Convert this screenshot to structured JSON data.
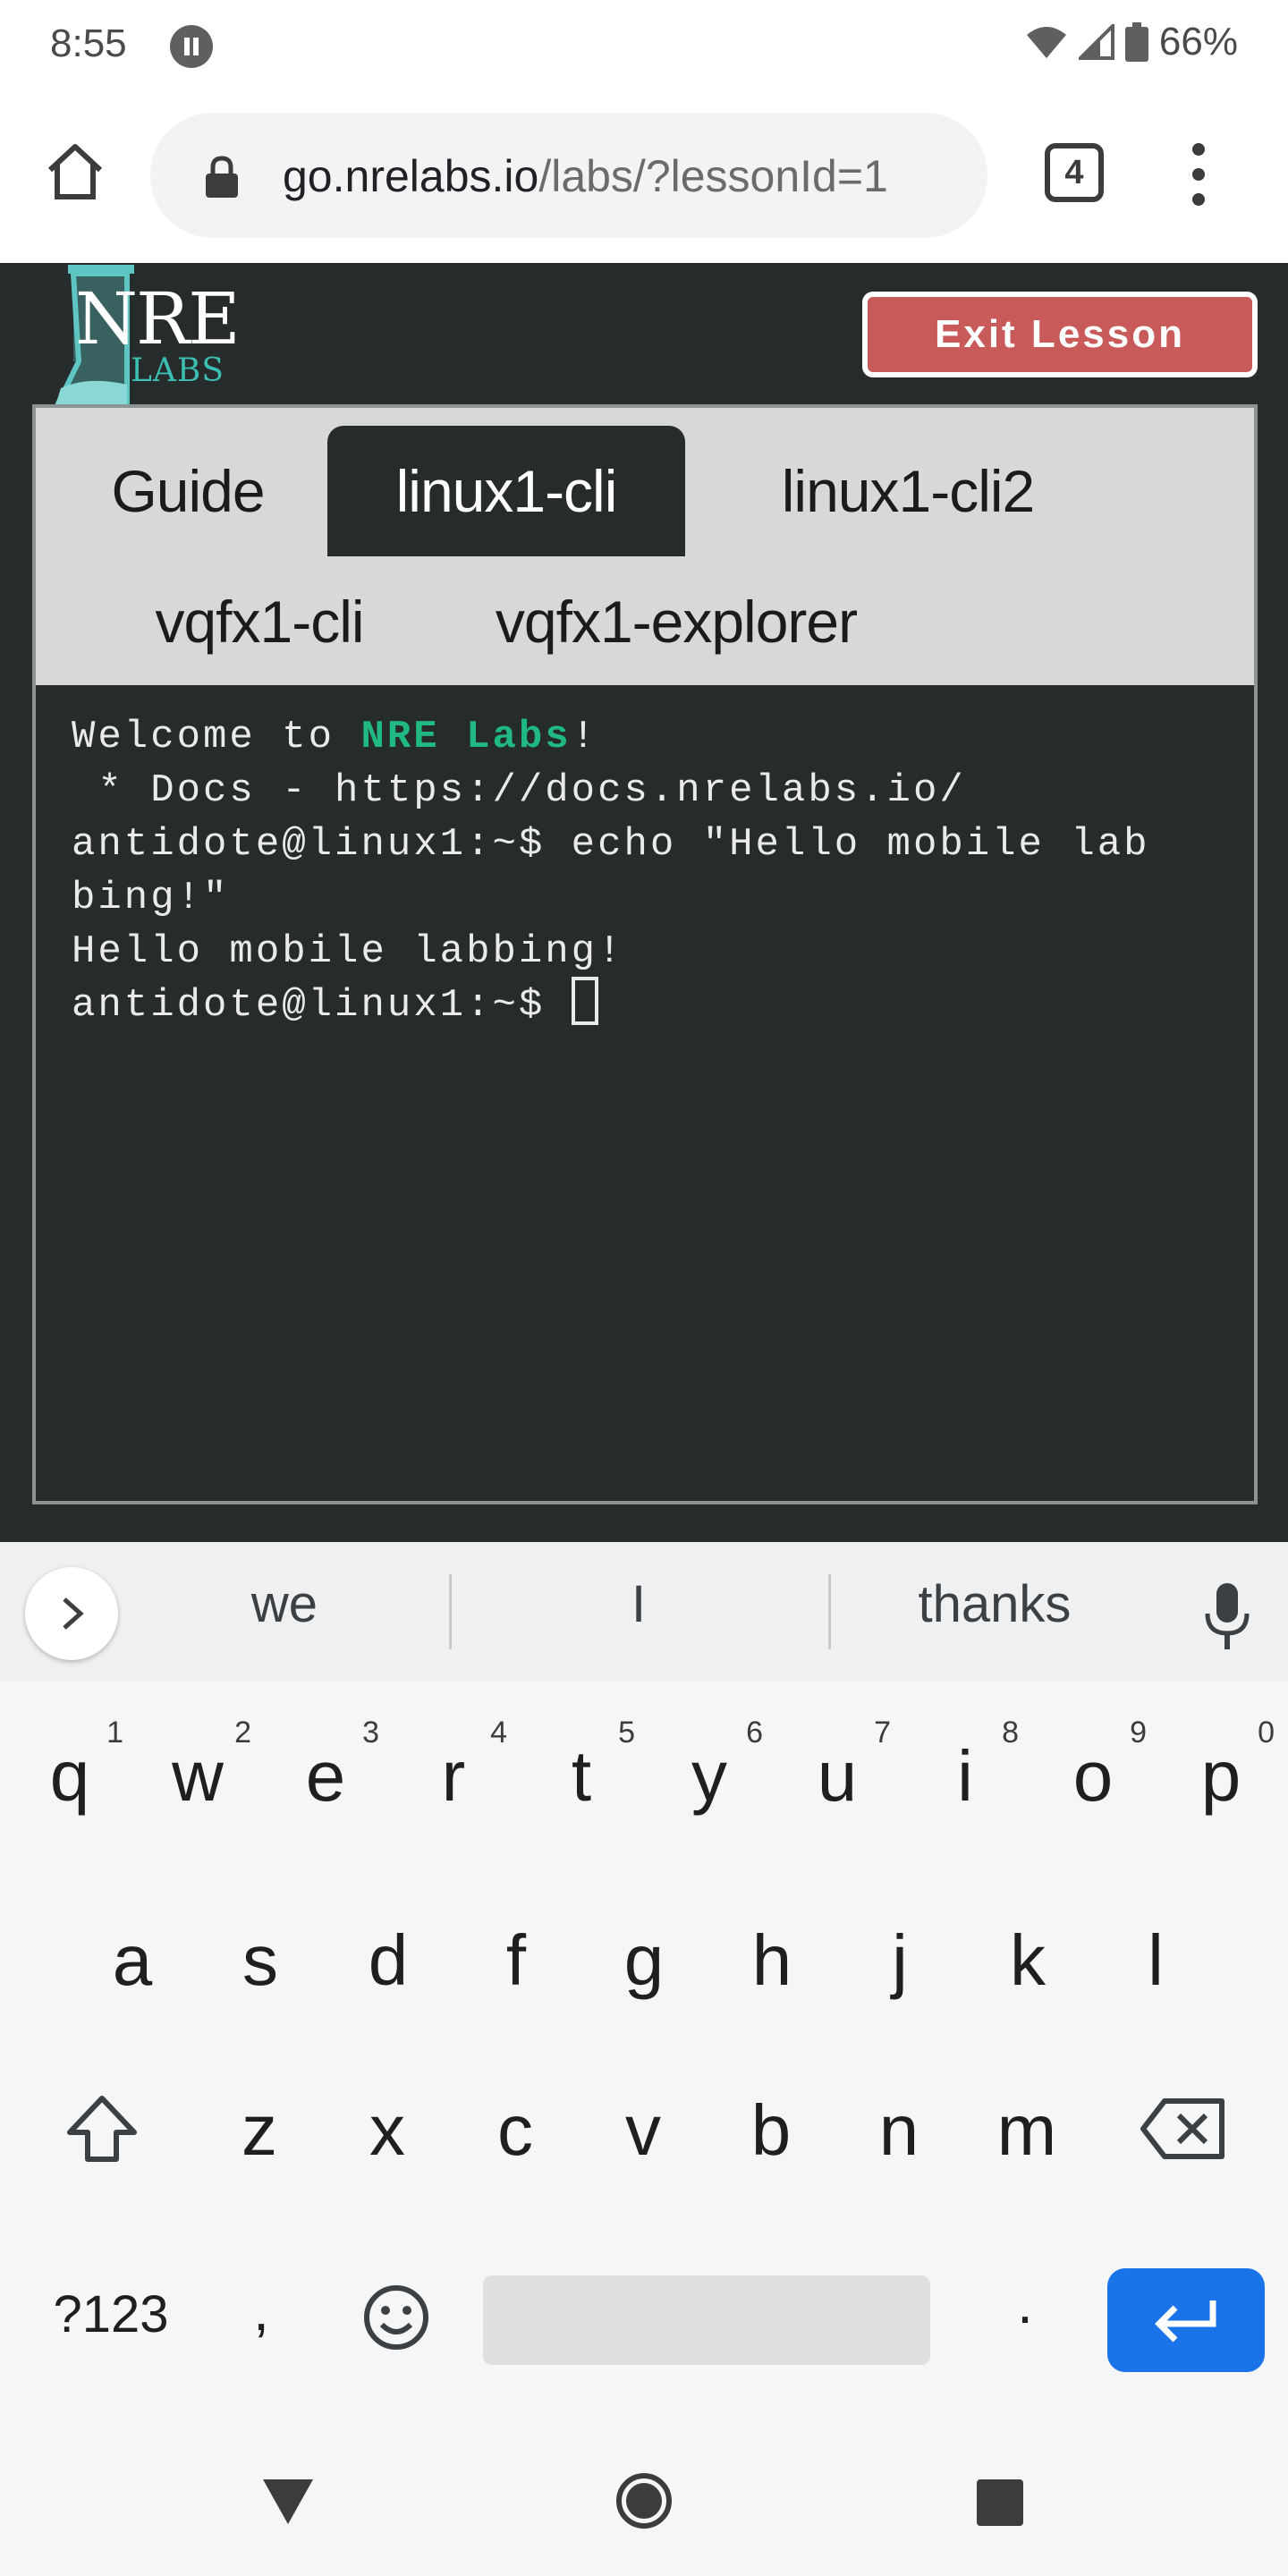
{
  "status_bar": {
    "time": "8:55",
    "battery": "66%"
  },
  "browser": {
    "url_host": "go.nrelabs.io",
    "url_path": "/labs/?lessonId=1",
    "tab_count": "4"
  },
  "lab": {
    "logo": {
      "line1": "NRE",
      "line2": "LABS"
    },
    "exit_label": "Exit Lesson",
    "tabs": [
      {
        "label": "Guide",
        "active": false
      },
      {
        "label": "linux1-cli",
        "active": true
      },
      {
        "label": "linux1-cli2",
        "active": false
      },
      {
        "label": "vqfx1-cli",
        "active": false
      },
      {
        "label": "vqfx1-explorer",
        "active": false
      }
    ],
    "terminal": {
      "welcome_pre": "Welcome to ",
      "welcome_hl": "NRE Labs",
      "welcome_post": "!",
      "lines": [
        " * Docs - https://docs.nrelabs.io/",
        "antidote@linux1:~$ echo \"Hello mobile lab",
        "bing!\"",
        "Hello mobile labbing!"
      ],
      "prompt": "antidote@linux1:~$ "
    }
  },
  "keyboard": {
    "suggestions": [
      "we",
      "I",
      "thanks"
    ],
    "row1": [
      {
        "key": "q",
        "hint": "1"
      },
      {
        "key": "w",
        "hint": "2"
      },
      {
        "key": "e",
        "hint": "3"
      },
      {
        "key": "r",
        "hint": "4"
      },
      {
        "key": "t",
        "hint": "5"
      },
      {
        "key": "y",
        "hint": "6"
      },
      {
        "key": "u",
        "hint": "7"
      },
      {
        "key": "i",
        "hint": "8"
      },
      {
        "key": "o",
        "hint": "9"
      },
      {
        "key": "p",
        "hint": "0"
      }
    ],
    "row2": [
      "a",
      "s",
      "d",
      "f",
      "g",
      "h",
      "j",
      "k",
      "l"
    ],
    "row3": [
      "z",
      "x",
      "c",
      "v",
      "b",
      "n",
      "m"
    ],
    "symbols_label": "?123",
    "comma": ",",
    "period": "."
  }
}
